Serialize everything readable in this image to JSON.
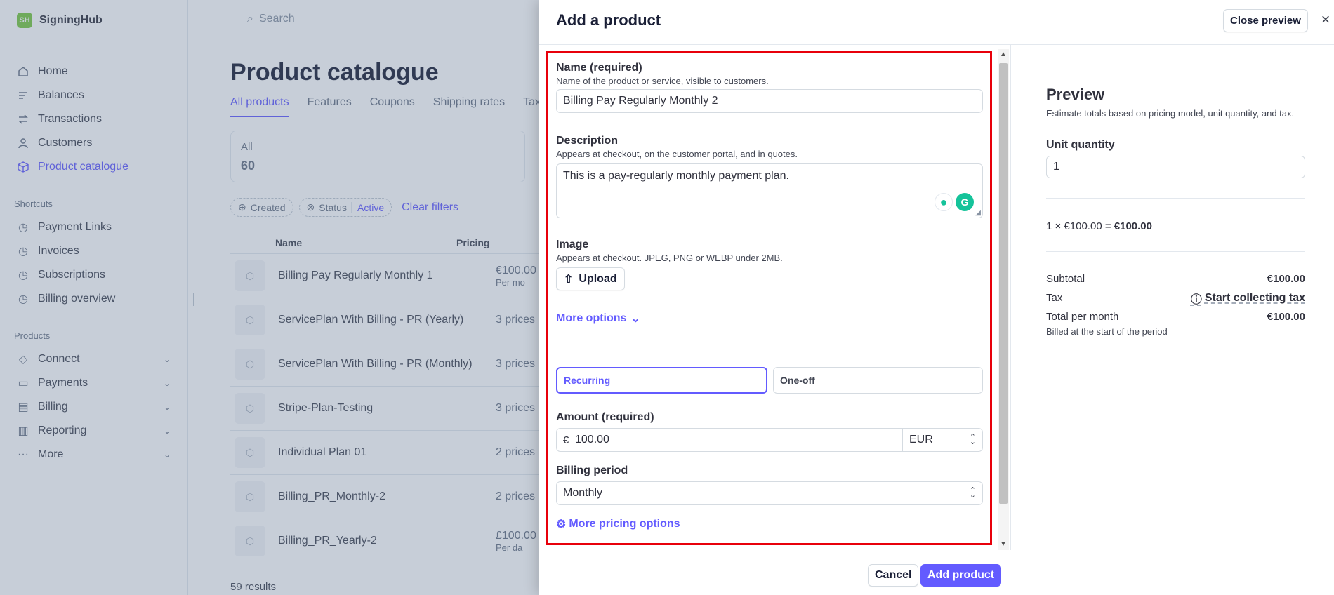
{
  "sidebar": {
    "brand": {
      "logo": "SH",
      "name": "SigningHub"
    },
    "items": [
      {
        "label": "Home",
        "icon": "home-icon"
      },
      {
        "label": "Balances",
        "icon": "balances-icon"
      },
      {
        "label": "Transactions",
        "icon": "transactions-icon"
      },
      {
        "label": "Customers",
        "icon": "customers-icon"
      },
      {
        "label": "Product catalogue",
        "icon": "product-icon",
        "active": true
      }
    ],
    "shortcuts_title": "Shortcuts",
    "shortcuts": [
      {
        "label": "Payment Links",
        "icon": "clock-icon"
      },
      {
        "label": "Invoices",
        "icon": "clock-icon"
      },
      {
        "label": "Subscriptions",
        "icon": "clock-icon"
      },
      {
        "label": "Billing overview",
        "icon": "clock-icon"
      }
    ],
    "products_title": "Products",
    "products": [
      {
        "label": "Connect",
        "icon": "connect-icon"
      },
      {
        "label": "Payments",
        "icon": "payments-icon"
      },
      {
        "label": "Billing",
        "icon": "billing-icon"
      },
      {
        "label": "Reporting",
        "icon": "reporting-icon"
      },
      {
        "label": "More",
        "icon": "more-icon"
      }
    ]
  },
  "main": {
    "search_placeholder": "Search",
    "title": "Product catalogue",
    "tabs": [
      "All products",
      "Features",
      "Coupons",
      "Shipping rates",
      "Tax"
    ],
    "stat": {
      "label": "All",
      "value": "60"
    },
    "filters": {
      "created": "Created",
      "status": "Status",
      "status_value": "Active",
      "clear": "Clear filters"
    },
    "columns": [
      "Name",
      "Pricing"
    ],
    "rows": [
      {
        "name": "Billing Pay Regularly Monthly 1",
        "pricing": "€100.00",
        "pricing_sub": "Per mo"
      },
      {
        "name": "ServicePlan With Billing - PR (Yearly)",
        "pricing": "3 prices",
        "pricing_sub": ""
      },
      {
        "name": "ServicePlan With Billing - PR (Monthly)",
        "pricing": "3 prices",
        "pricing_sub": ""
      },
      {
        "name": "Stripe-Plan-Testing",
        "pricing": "3 prices",
        "pricing_sub": ""
      },
      {
        "name": "Individual Plan 01",
        "pricing": "2 prices",
        "pricing_sub": ""
      },
      {
        "name": "Billing_PR_Monthly-2",
        "pricing": "2 prices",
        "pricing_sub": ""
      },
      {
        "name": "Billing_PR_Yearly-2",
        "pricing": "£100.00",
        "pricing_sub": "Per da"
      }
    ],
    "results": "59 results"
  },
  "drawer": {
    "title": "Add a product",
    "close_preview": "Close preview",
    "close_icon": "×",
    "form": {
      "name_label": "Name (required)",
      "name_help": "Name of the product or service, visible to customers.",
      "name_value": "Billing Pay Regularly Monthly 2",
      "description_label": "Description",
      "description_help": "Appears at checkout, on the customer portal, and in quotes.",
      "description_value": "This is a pay-regularly monthly payment plan.",
      "image_label": "Image",
      "image_help": "Appears at checkout. JPEG, PNG or WEBP under 2MB.",
      "upload_label": "Upload",
      "more_options": "More options",
      "pricing_options": [
        "Recurring",
        "One-off"
      ],
      "selected_pricing": "Recurring",
      "amount_label": "Amount (required)",
      "currency_symbol": "€",
      "amount_value": "100.00",
      "currency": "EUR",
      "billing_period_label": "Billing period",
      "billing_period_value": "Monthly",
      "more_pricing_options": "More pricing options"
    },
    "footer": {
      "cancel": "Cancel",
      "add": "Add product"
    },
    "preview": {
      "title": "Preview",
      "subtitle": "Estimate totals based on pricing model, unit quantity, and tax.",
      "unit_quantity_label": "Unit quantity",
      "unit_quantity_value": "1",
      "calc_prefix": "1 × €100.00 = ",
      "calc_total": "€100.00",
      "subtotal_label": "Subtotal",
      "subtotal_value": "€100.00",
      "tax_label": "Tax",
      "tax_link": "Start collecting tax",
      "total_label": "Total per month",
      "total_value": "€100.00",
      "billed_note": "Billed at the start of the period"
    }
  },
  "colors": {
    "accent": "#635bff",
    "highlight": "#e8000b",
    "brand": "#7ac943"
  }
}
